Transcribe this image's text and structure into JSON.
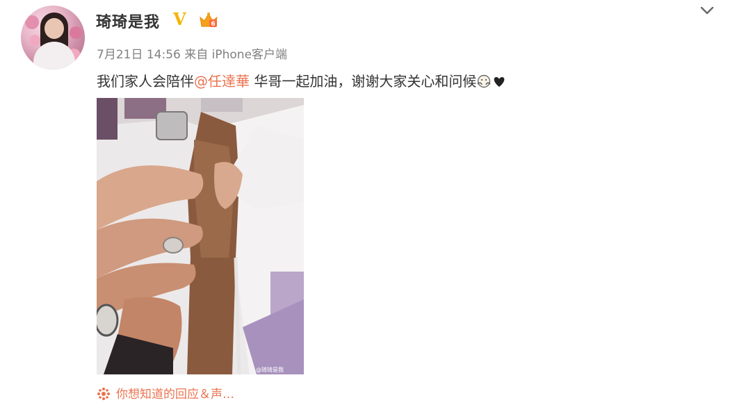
{
  "post": {
    "author": "琦琦是我",
    "verified_badge": "V",
    "meta": "7月21日 14:56 来自 iPhone客户端",
    "text_before": "我们家人会陪伴",
    "mention": "@任達華",
    "text_after": " 华哥一起加油，谢谢大家关心和问候",
    "image_watermark": "@琦琦是我",
    "footer_link": "你想知道的回应＆声…"
  },
  "icons": {
    "avatar": "avatar-photo",
    "verified": "verified-v-icon",
    "member": "crown-member-icon",
    "menu": "chevron-down-icon",
    "emoji1": "hug-emoji-icon",
    "emoji2": "black-heart-icon",
    "footer": "sun-link-icon"
  },
  "colors": {
    "link": "#eb7350",
    "verified": "#f5b400",
    "meta": "#808080",
    "text": "#333333"
  }
}
